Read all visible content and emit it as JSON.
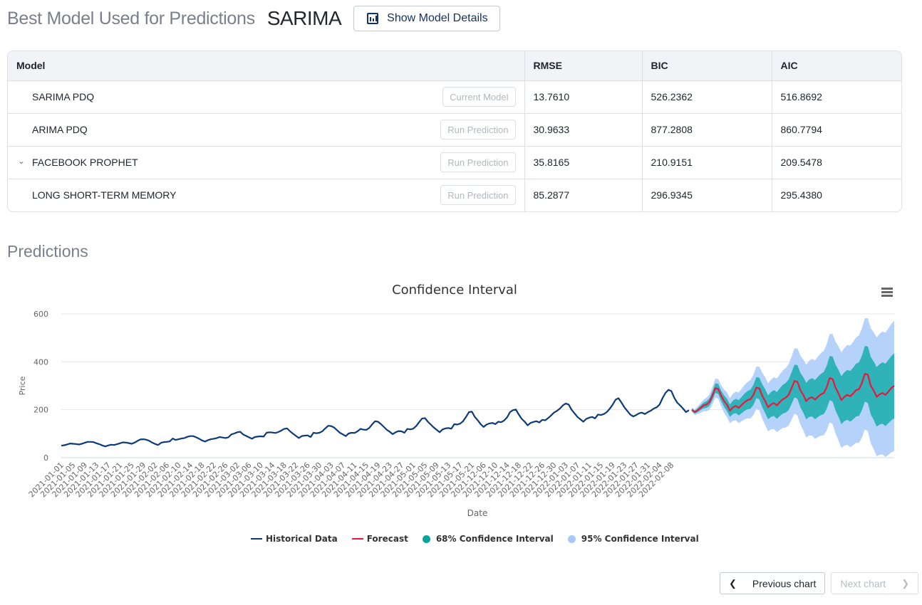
{
  "header": {
    "subtitle": "Best Model Used for Predictions",
    "best_model": "SARIMA",
    "details_button": "Show Model Details",
    "details_icon": "bar-chart-icon"
  },
  "table": {
    "columns": [
      "Model",
      "RMSE",
      "BIC",
      "AIC"
    ],
    "rows": [
      {
        "model": "SARIMA PDQ",
        "button": "Current Model",
        "expandable": false,
        "rmse": "13.7610",
        "bic": "526.2362",
        "aic": "516.8692"
      },
      {
        "model": "ARIMA PDQ",
        "button": "Run Prediction",
        "expandable": false,
        "rmse": "30.9633",
        "bic": "877.2808",
        "aic": "860.7794"
      },
      {
        "model": "FACEBOOK PROPHET",
        "button": "Run Prediction",
        "expandable": true,
        "rmse": "35.8165",
        "bic": "210.9151",
        "aic": "209.5478"
      },
      {
        "model": "LONG SHORT-TERM MEMORY",
        "button": "Run Prediction",
        "expandable": false,
        "rmse": "85.2877",
        "bic": "296.9345",
        "aic": "295.4380"
      }
    ]
  },
  "predictions_title": "Predictions",
  "navigation": {
    "previous": "Previous chart",
    "next": "Next chart"
  },
  "chart_data": {
    "type": "line",
    "title": "Confidence Interval",
    "xlabel": "Date",
    "ylabel": "Price",
    "ylim": [
      0,
      600
    ],
    "yticks": [
      0,
      200,
      400,
      600
    ],
    "grid": true,
    "legend_position": "bottom",
    "colors": {
      "historical": "#0d3b78",
      "forecast": "#e8193c",
      "ci68": "#1aaaaa",
      "ci95": "#a9cbfa"
    },
    "x_tick_labels": [
      "2021-01-01",
      "2021-01-05",
      "2021-01-09",
      "2021-01-13",
      "2021-01-17",
      "2021-01-21",
      "2021-01-25",
      "2021-01-29",
      "2021-02-02",
      "2021-02-06",
      "2021-02-10",
      "2021-02-14",
      "2021-02-18",
      "2021-02-22",
      "2021-02-26",
      "2021-03-02",
      "2021-03-06",
      "2021-03-10",
      "2021-03-14",
      "2021-03-18",
      "2021-03-22",
      "2021-03-26",
      "2021-03-30",
      "2021-04-03",
      "2021-04-07",
      "2021-04-11",
      "2021-04-15",
      "2021-04-19",
      "2021-04-23",
      "2021-04-27",
      "2021-05-01",
      "2021-05-05",
      "2021-05-09",
      "2021-05-13",
      "2021-05-17",
      "2021-05-21",
      "2021-12-06",
      "2021-12-10",
      "2021-12-14",
      "2021-12-18",
      "2021-12-22",
      "2021-12-26",
      "2021-12-30",
      "2022-01-03",
      "2022-01-07",
      "2022-01-11",
      "2022-01-15",
      "2022-01-19",
      "2022-01-23",
      "2022-01-27",
      "2022-01-31",
      "2022-02-04",
      "2022-02-08"
    ],
    "legend": [
      "Historical Data",
      "Forecast",
      "68% Confidence Interval",
      "95% Confidence Interval"
    ],
    "series": [
      {
        "name": "Historical Data",
        "values": [
          50,
          52,
          55,
          59,
          58,
          57,
          55,
          58,
          62,
          66,
          66,
          65,
          60,
          56,
          51,
          47,
          51,
          54,
          53,
          56,
          60,
          64,
          63,
          61,
          58,
          63,
          70,
          76,
          77,
          75,
          70,
          63,
          57,
          53,
          62,
          65,
          66,
          68,
          80,
          74,
          77,
          80,
          82,
          87,
          90,
          90,
          85,
          79,
          72,
          67,
          73,
          77,
          79,
          82,
          86,
          84,
          82,
          85,
          97,
          101,
          106,
          108,
          97,
          91,
          85,
          79,
          86,
          88,
          89,
          88,
          104,
          106,
          105,
          103,
          107,
          113,
          120,
          122,
          110,
          100,
          91,
          82,
          90,
          92,
          93,
          86,
          104,
          102,
          104,
          110,
          122,
          133,
          132,
          126,
          115,
          104,
          97,
          90,
          101,
          104,
          103,
          110,
          120,
          117,
          116,
          124,
          139,
          152,
          150,
          140,
          128,
          116,
          108,
          98,
          106,
          111,
          110,
          104,
          120,
          118,
          121,
          132,
          148,
          163,
          165,
          150,
          138,
          126,
          116,
          106,
          118,
          122,
          124,
          121,
          140,
          138,
          142,
          152,
          170,
          190,
          192,
          170,
          156,
          140,
          128,
          138,
          143,
          145,
          140,
          150,
          148,
          155,
          168,
          190,
          198,
          201,
          180,
          162,
          150,
          135,
          145,
          149,
          152,
          147,
          158,
          156,
          165,
          176,
          188,
          195,
          205,
          218,
          226,
          222,
          200,
          185,
          170,
          160,
          150,
          162,
          167,
          170,
          164,
          180,
          178,
          182,
          190,
          204,
          221,
          242,
          248,
          230,
          210,
          195,
          180,
          172,
          178,
          185,
          188,
          182,
          190,
          196,
          205,
          210,
          222,
          248,
          270,
          283,
          278,
          250,
          230,
          218,
          205,
          190,
          198
        ]
      },
      {
        "name": "Forecast",
        "values": [
          200,
          190,
          198,
          208,
          218,
          222,
          232,
          258,
          290,
          287,
          258,
          236,
          220,
          196,
          210,
          216,
          208,
          220,
          232,
          240,
          244,
          262,
          292,
          289,
          258,
          236,
          210,
          222,
          228,
          218,
          232,
          244,
          250,
          262,
          290,
          320,
          316,
          282,
          262,
          236,
          248,
          252,
          242,
          254,
          264,
          270,
          294,
          332,
          328,
          292,
          268,
          240,
          254,
          262,
          256,
          268,
          282,
          286,
          312,
          350,
          346,
          300,
          280,
          254,
          264,
          270,
          262,
          276,
          290,
          300
        ]
      },
      {
        "name": "68% Confidence Interval",
        "lower": [
          195,
          184,
          190,
          198,
          206,
          208,
          216,
          240,
          270,
          266,
          236,
          212,
          194,
          170,
          182,
          186,
          176,
          186,
          196,
          202,
          204,
          220,
          248,
          244,
          210,
          186,
          160,
          170,
          174,
          162,
          174,
          184,
          188,
          198,
          224,
          252,
          246,
          210,
          188,
          160,
          170,
          172,
          160,
          170,
          178,
          182,
          204,
          240,
          234,
          196,
          170,
          140,
          152,
          158,
          150,
          160,
          172,
          174,
          198,
          234,
          228,
          180,
          158,
          130,
          138,
          142,
          132,
          144,
          156,
          164
        ],
        "upper": [
          205,
          196,
          206,
          218,
          230,
          236,
          248,
          276,
          310,
          308,
          280,
          260,
          246,
          222,
          238,
          246,
          240,
          254,
          268,
          278,
          284,
          304,
          336,
          334,
          306,
          286,
          260,
          274,
          282,
          274,
          290,
          304,
          312,
          326,
          356,
          388,
          386,
          354,
          336,
          312,
          326,
          332,
          324,
          338,
          350,
          358,
          384,
          424,
          422,
          388,
          366,
          340,
          356,
          366,
          362,
          376,
          392,
          398,
          426,
          466,
          464,
          420,
          402,
          378,
          390,
          398,
          392,
          408,
          424,
          436
        ]
      },
      {
        "name": "95% Confidence Interval",
        "lower": [
          191,
          178,
          182,
          188,
          194,
          194,
          200,
          222,
          250,
          246,
          214,
          188,
          168,
          144,
          154,
          156,
          144,
          152,
          160,
          164,
          164,
          178,
          204,
          198,
          162,
          136,
          110,
          118,
          120,
          106,
          116,
          124,
          126,
          134,
          158,
          184,
          176,
          138,
          114,
          84,
          92,
          92,
          78,
          86,
          92,
          94,
          114,
          148,
          140,
          100,
          72,
          40,
          50,
          54,
          44,
          52,
          62,
          62,
          84,
          118,
          110,
          60,
          36,
          6,
          12,
          14,
          2,
          12,
          22,
          28
        ],
        "upper": [
          209,
          202,
          214,
          228,
          242,
          250,
          264,
          294,
          330,
          328,
          302,
          284,
          272,
          248,
          266,
          276,
          272,
          288,
          304,
          316,
          324,
          346,
          380,
          380,
          354,
          336,
          310,
          326,
          336,
          330,
          348,
          364,
          374,
          390,
          422,
          456,
          456,
          426,
          410,
          388,
          404,
          412,
          406,
          422,
          436,
          446,
          474,
          516,
          516,
          484,
          464,
          440,
          458,
          470,
          468,
          484,
          502,
          510,
          540,
          582,
          582,
          540,
          524,
          502,
          516,
          526,
          522,
          540,
          558,
          572
        ]
      }
    ]
  }
}
